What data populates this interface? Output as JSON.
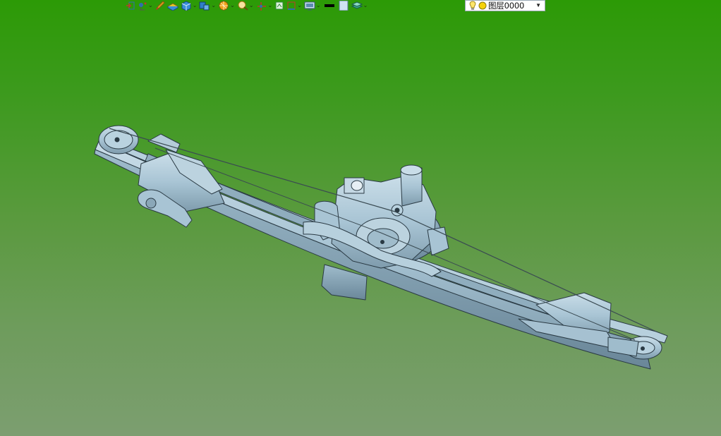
{
  "toolbar": {
    "buttons": [
      {
        "name": "import-icon",
        "dropdown": false,
        "color": "#c0392b"
      },
      {
        "name": "point-icon",
        "dropdown": true,
        "color": "#2f6fb0"
      },
      {
        "name": "pencil-icon",
        "dropdown": false,
        "color": "#d9a21a"
      },
      {
        "name": "surface-icon",
        "dropdown": false,
        "color": "#e6c52b"
      },
      {
        "name": "solid-box-icon",
        "dropdown": true,
        "color": "#3a8fd8"
      },
      {
        "name": "assembly-icon",
        "dropdown": true,
        "color": "#2f7fc8"
      },
      {
        "name": "render-sphere-icon",
        "dropdown": true,
        "color": "#f0a21a"
      },
      {
        "name": "zoom-icon",
        "dropdown": true,
        "color": "#e8b830"
      },
      {
        "name": "axis-icon",
        "dropdown": true,
        "color": "#c0392b"
      },
      {
        "name": "snap-icon",
        "dropdown": false,
        "color": "#2e8b3a"
      },
      {
        "name": "frame-icon",
        "dropdown": true,
        "color": "#c0392b"
      },
      {
        "name": "display-mode-icon",
        "dropdown": true,
        "color": "#5a8ab0"
      },
      {
        "name": "line-color-icon",
        "dropdown": false,
        "color": "#000000"
      },
      {
        "name": "fill-color-icon",
        "dropdown": false,
        "color": "#cfe3f3"
      },
      {
        "name": "layer-manager-icon",
        "dropdown": true,
        "color": "#3aa58a"
      }
    ],
    "layer": {
      "name": "图层0000",
      "bulb_icon": "lightbulb-icon",
      "status_icon": "yellow-circle-icon"
    }
  },
  "viewport": {
    "background_top": "#2c9a06",
    "background_bottom": "#7c9e70",
    "model_color": "#a8c4d4",
    "model_edge_color": "#2a3a44"
  }
}
